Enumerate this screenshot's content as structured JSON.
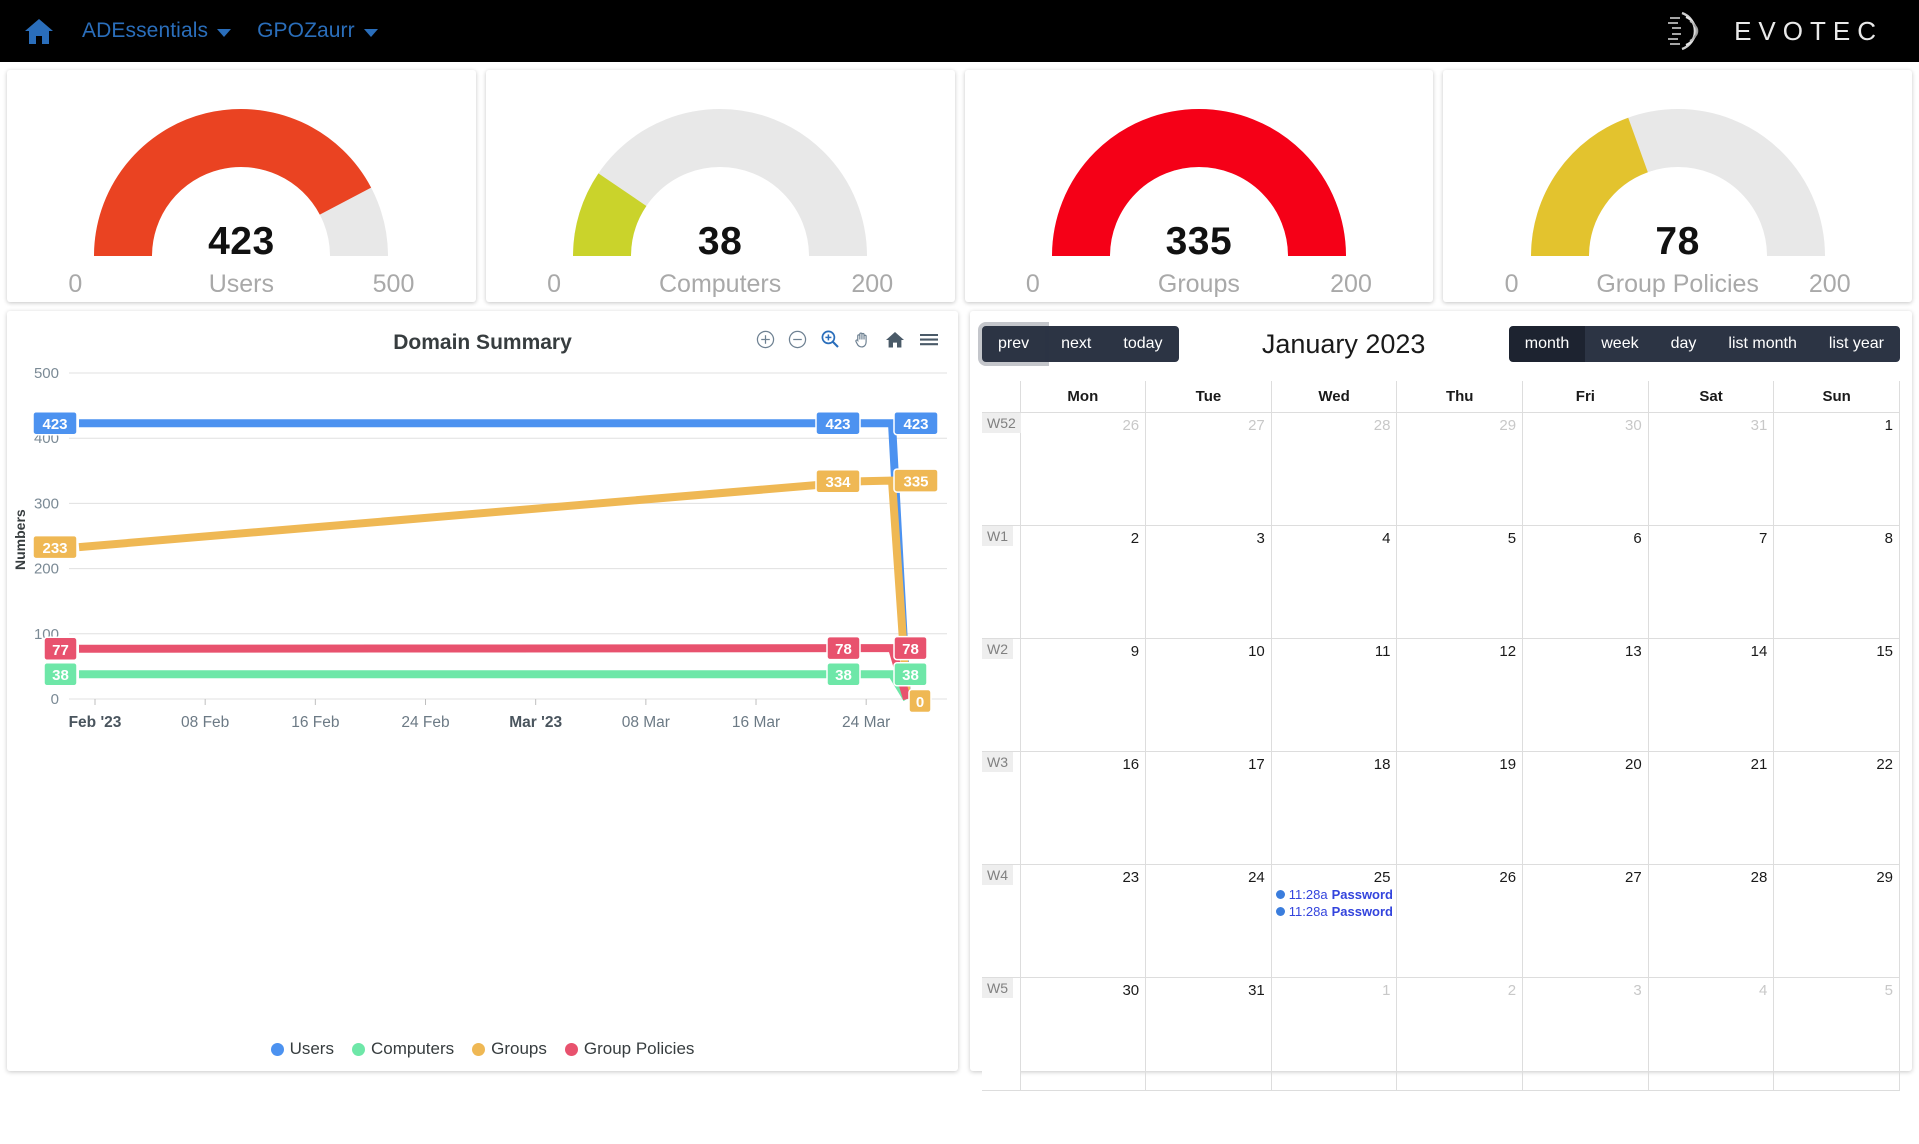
{
  "navbar": {
    "home_icon": "home-icon",
    "items": [
      {
        "label": "ADEssentials"
      },
      {
        "label": "GPOZaurr"
      }
    ],
    "brand": "EVOTEC"
  },
  "gauges": [
    {
      "title": "Users",
      "value": "423",
      "min": "0",
      "max": "500",
      "value_num": 423,
      "max_num": 500,
      "color": "#ea4322",
      "track": "#e8e8e8"
    },
    {
      "title": "Computers",
      "value": "38",
      "min": "0",
      "max": "200",
      "value_num": 38,
      "max_num": 200,
      "color": "#cad32b",
      "track": "#e8e8e8"
    },
    {
      "title": "Groups",
      "value": "335",
      "min": "0",
      "max": "200",
      "value_num": 335,
      "max_num": 200,
      "color": "#f50017",
      "track": "#e8e8e8"
    },
    {
      "title": "Group Policies",
      "value": "78",
      "min": "0",
      "max": "200",
      "value_num": 78,
      "max_num": 200,
      "color": "#e3c32e",
      "track": "#e8e8e8"
    }
  ],
  "chart_panel": {
    "title": "Domain Summary",
    "toolbar": [
      {
        "name": "zoom-in-icon",
        "label": "Zoom In"
      },
      {
        "name": "zoom-out-icon",
        "label": "Zoom Out"
      },
      {
        "name": "selection-zoom-icon",
        "label": "Selection Zoom"
      },
      {
        "name": "panning-icon",
        "label": "Panning"
      },
      {
        "name": "reset-zoom-icon",
        "label": "Reset Zoom"
      },
      {
        "name": "menu-icon",
        "label": "Menu"
      }
    ]
  },
  "chart_data": {
    "type": "line",
    "title": "Domain Summary",
    "xlabel": "",
    "ylabel": "Numbers",
    "ylim": [
      0,
      500
    ],
    "yticks": [
      "0",
      "100",
      "200",
      "300",
      "400",
      "500"
    ],
    "xticks": [
      "Feb '23",
      "08 Feb",
      "16 Feb",
      "24 Feb",
      "Mar '23",
      "08 Mar",
      "16 Mar",
      "24 Mar"
    ],
    "grid": true,
    "legend_position": "bottom",
    "series": [
      {
        "name": "Users",
        "color": "#4c92f0",
        "values": [
          423,
          423,
          423,
          0
        ],
        "start_label": "423",
        "end_labels": [
          "423",
          "423"
        ]
      },
      {
        "name": "Computers",
        "color": "#6ee7a8",
        "values": [
          38,
          38,
          38,
          0
        ],
        "start_label": "38",
        "end_labels": [
          "38",
          "38"
        ]
      },
      {
        "name": "Groups",
        "color": "#efb854",
        "values": [
          233,
          334,
          335,
          0
        ],
        "start_label": "233",
        "end_labels": [
          "334",
          "335"
        ],
        "zero_label": "0"
      },
      {
        "name": "Group Policies",
        "color": "#e8526e",
        "values": [
          77,
          78,
          78,
          0
        ],
        "start_label": "77",
        "end_labels": [
          "78",
          "78"
        ]
      }
    ]
  },
  "calendar": {
    "title": "January 2023",
    "nav_buttons": [
      {
        "label": "prev",
        "state": "focused"
      },
      {
        "label": "next",
        "state": "normal"
      },
      {
        "label": "today",
        "state": "normal"
      }
    ],
    "view_buttons": [
      {
        "label": "month",
        "state": "active"
      },
      {
        "label": "week",
        "state": "normal"
      },
      {
        "label": "day",
        "state": "normal"
      },
      {
        "label": "list month",
        "state": "normal"
      },
      {
        "label": "list year",
        "state": "normal"
      }
    ],
    "day_headers": [
      "Mon",
      "Tue",
      "Wed",
      "Thu",
      "Fri",
      "Sat",
      "Sun"
    ],
    "weeks": [
      {
        "week": "W52",
        "days": [
          {
            "num": "26",
            "other": true,
            "events": []
          },
          {
            "num": "27",
            "other": true,
            "events": []
          },
          {
            "num": "28",
            "other": true,
            "events": []
          },
          {
            "num": "29",
            "other": true,
            "events": []
          },
          {
            "num": "30",
            "other": true,
            "events": []
          },
          {
            "num": "31",
            "other": true,
            "events": []
          },
          {
            "num": "1",
            "other": false,
            "events": []
          }
        ]
      },
      {
        "week": "W1",
        "days": [
          {
            "num": "2",
            "other": false,
            "events": []
          },
          {
            "num": "3",
            "other": false,
            "events": []
          },
          {
            "num": "4",
            "other": false,
            "events": []
          },
          {
            "num": "5",
            "other": false,
            "events": []
          },
          {
            "num": "6",
            "other": false,
            "events": []
          },
          {
            "num": "7",
            "other": false,
            "events": []
          },
          {
            "num": "8",
            "other": false,
            "events": []
          }
        ]
      },
      {
        "week": "W2",
        "days": [
          {
            "num": "9",
            "other": false,
            "events": []
          },
          {
            "num": "10",
            "other": false,
            "events": []
          },
          {
            "num": "11",
            "other": false,
            "events": []
          },
          {
            "num": "12",
            "other": false,
            "events": []
          },
          {
            "num": "13",
            "other": false,
            "events": []
          },
          {
            "num": "14",
            "other": false,
            "events": []
          },
          {
            "num": "15",
            "other": false,
            "events": []
          }
        ]
      },
      {
        "week": "W3",
        "days": [
          {
            "num": "16",
            "other": false,
            "events": []
          },
          {
            "num": "17",
            "other": false,
            "events": []
          },
          {
            "num": "18",
            "other": false,
            "events": []
          },
          {
            "num": "19",
            "other": false,
            "events": []
          },
          {
            "num": "20",
            "other": false,
            "events": []
          },
          {
            "num": "21",
            "other": false,
            "events": []
          },
          {
            "num": "22",
            "other": false,
            "events": []
          }
        ]
      },
      {
        "week": "W4",
        "days": [
          {
            "num": "23",
            "other": false,
            "events": []
          },
          {
            "num": "24",
            "other": false,
            "events": []
          },
          {
            "num": "25",
            "other": false,
            "events": [
              {
                "time": "11:28a",
                "title": "Password Qualit"
              },
              {
                "time": "11:28a",
                "title": "Password Qualit"
              }
            ]
          },
          {
            "num": "26",
            "other": false,
            "events": []
          },
          {
            "num": "27",
            "other": false,
            "events": []
          },
          {
            "num": "28",
            "other": false,
            "events": []
          },
          {
            "num": "29",
            "other": false,
            "events": []
          }
        ]
      },
      {
        "week": "W5",
        "days": [
          {
            "num": "30",
            "other": false,
            "events": []
          },
          {
            "num": "31",
            "other": false,
            "events": []
          },
          {
            "num": "1",
            "other": true,
            "events": []
          },
          {
            "num": "2",
            "other": true,
            "events": []
          },
          {
            "num": "3",
            "other": true,
            "events": []
          },
          {
            "num": "4",
            "other": true,
            "events": []
          },
          {
            "num": "5",
            "other": true,
            "events": []
          }
        ]
      }
    ]
  }
}
